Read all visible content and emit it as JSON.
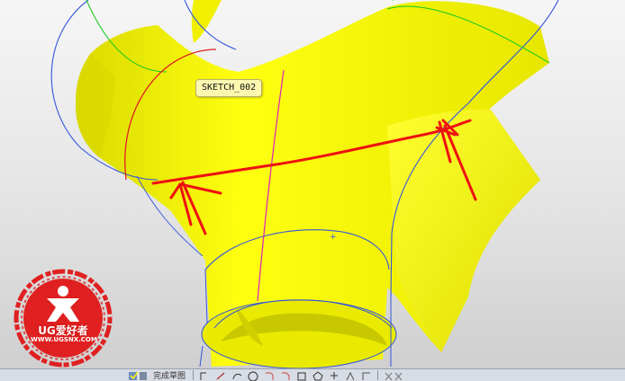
{
  "viewport": {
    "sketch_label": "SKETCH_002"
  },
  "watermark": {
    "brand": "UG爱好者",
    "url": "WWW.UGSNX.COM",
    "color": "#e02020"
  },
  "toolbar": {
    "finish_sketch_label": "完成草图",
    "icons": [
      "finish-sketch-icon",
      "profile-icon",
      "line-icon",
      "arc-icon",
      "circle-icon",
      "fillet-icon",
      "chamfer-icon",
      "rectangle-icon",
      "polygon-icon",
      "point-icon",
      "offset-curve-icon",
      "constraint-icon",
      "trim-icon"
    ]
  },
  "colors": {
    "surface": "#ffff00",
    "sketch_curve": "#3355dd",
    "guide_curve": "#e02020",
    "center_line": "#e020c0",
    "green_curve": "#22cc22"
  }
}
